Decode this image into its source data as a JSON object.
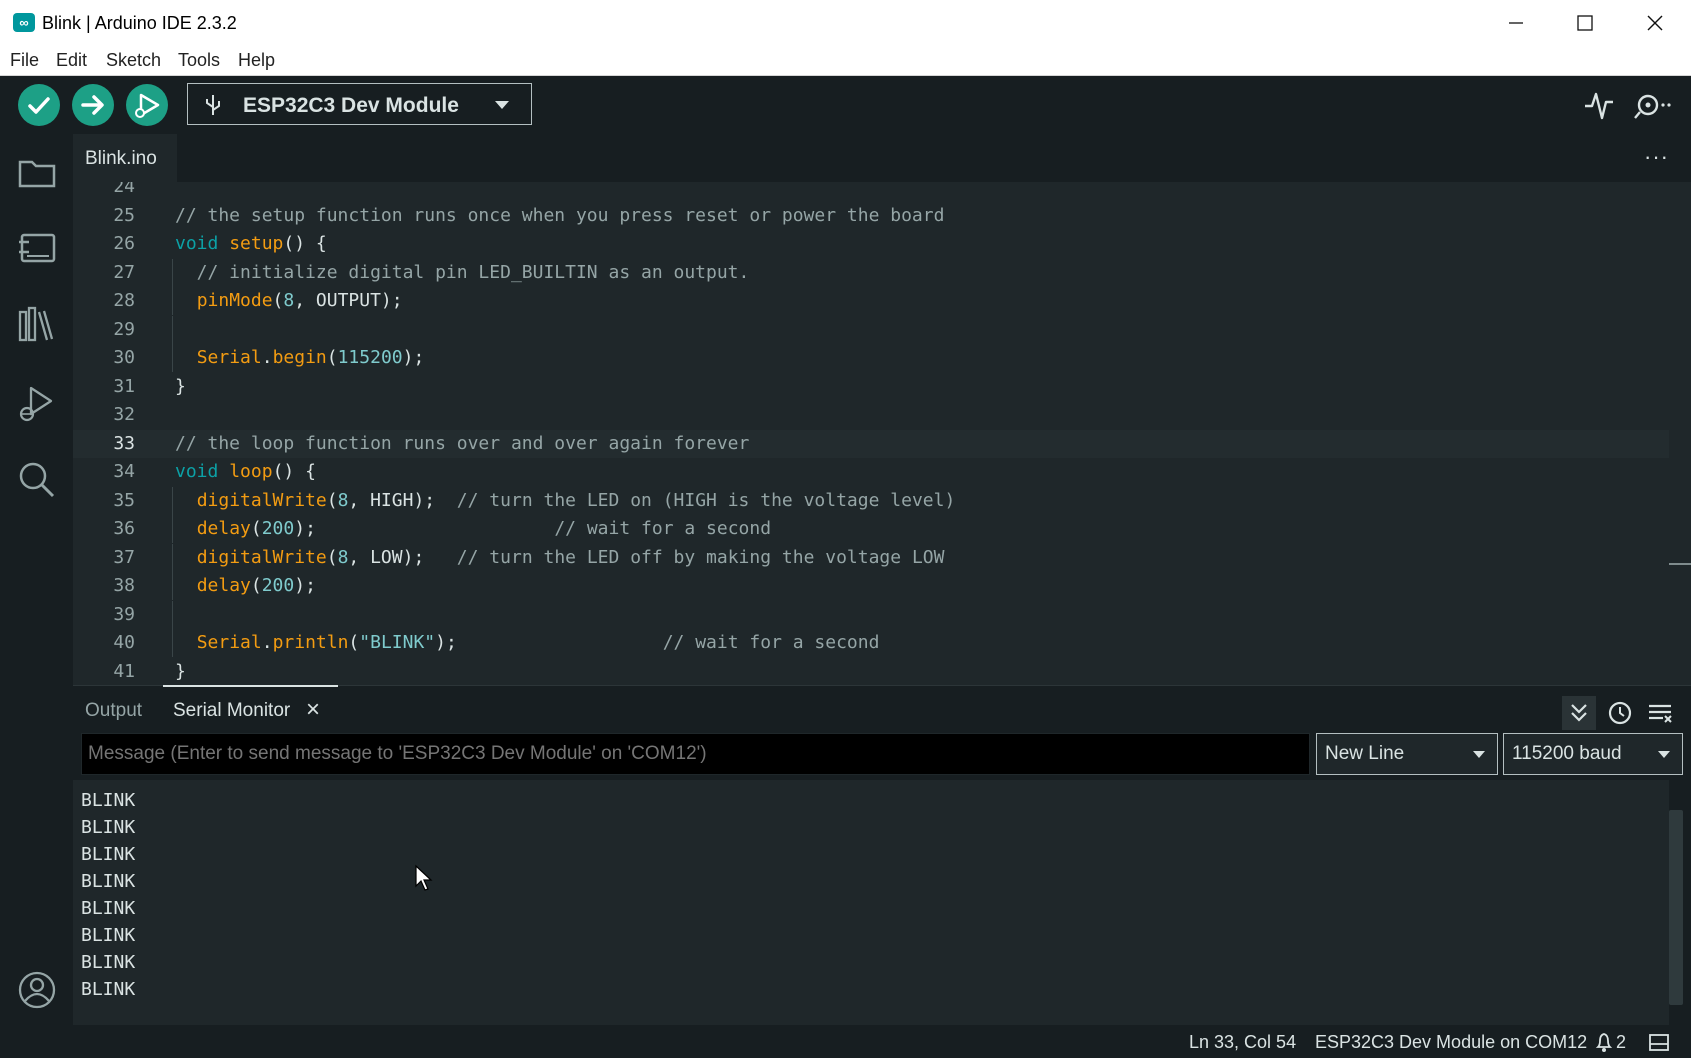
{
  "window": {
    "title": "Blink | Arduino IDE 2.3.2",
    "app_icon": "arduino-infinity-icon",
    "controls": [
      "minimize-icon",
      "maximize-icon",
      "close-icon"
    ]
  },
  "menu": [
    "File",
    "Edit",
    "Sketch",
    "Tools",
    "Help"
  ],
  "toolbar": {
    "verify": "check-icon",
    "upload": "arrow-right-icon",
    "debug": "debug-play-icon",
    "board": "ESP32C3 Dev Module",
    "serial_plotter": "pulse-icon",
    "serial_monitor": "serial-monitor-icon"
  },
  "sidebar": [
    "folder-icon",
    "board-icon",
    "library-icon",
    "debug-icon",
    "search-icon",
    "account-icon"
  ],
  "editor": {
    "tab": "Blink.ino",
    "more": "···",
    "active_line": 33,
    "lines": [
      {
        "n": "24",
        "tokens": []
      },
      {
        "n": "25",
        "tokens": [
          {
            "c": "t-cm",
            "t": "// the setup function runs once when you press reset or power the board"
          }
        ]
      },
      {
        "n": "26",
        "tokens": [
          {
            "c": "t-kw",
            "t": "void"
          },
          {
            "c": "t-txt",
            "t": " "
          },
          {
            "c": "t-fn",
            "t": "setup"
          },
          {
            "c": "t-txt",
            "t": "() {"
          }
        ]
      },
      {
        "n": "27",
        "tokens": [
          {
            "c": "t-cm",
            "t": "  // initialize digital pin LED_BUILTIN as an output."
          }
        ]
      },
      {
        "n": "28",
        "tokens": [
          {
            "c": "t-txt",
            "t": "  "
          },
          {
            "c": "t-fn",
            "t": "pinMode"
          },
          {
            "c": "t-txt",
            "t": "("
          },
          {
            "c": "t-num",
            "t": "8"
          },
          {
            "c": "t-txt",
            "t": ", OUTPUT);"
          }
        ]
      },
      {
        "n": "29",
        "tokens": []
      },
      {
        "n": "30",
        "tokens": [
          {
            "c": "t-txt",
            "t": "  "
          },
          {
            "c": "t-obj",
            "t": "Serial"
          },
          {
            "c": "t-txt",
            "t": "."
          },
          {
            "c": "t-fn",
            "t": "begin"
          },
          {
            "c": "t-txt",
            "t": "("
          },
          {
            "c": "t-num",
            "t": "115200"
          },
          {
            "c": "t-txt",
            "t": ");"
          }
        ]
      },
      {
        "n": "31",
        "tokens": [
          {
            "c": "t-txt",
            "t": "}"
          }
        ]
      },
      {
        "n": "32",
        "tokens": []
      },
      {
        "n": "33",
        "tokens": [
          {
            "c": "t-cm",
            "t": "// the loop function runs over and over again forever"
          }
        ]
      },
      {
        "n": "34",
        "tokens": [
          {
            "c": "t-kw",
            "t": "void"
          },
          {
            "c": "t-txt",
            "t": " "
          },
          {
            "c": "t-fn",
            "t": "loop"
          },
          {
            "c": "t-txt",
            "t": "() {"
          }
        ]
      },
      {
        "n": "35",
        "tokens": [
          {
            "c": "t-txt",
            "t": "  "
          },
          {
            "c": "t-fn",
            "t": "digitalWrite"
          },
          {
            "c": "t-txt",
            "t": "("
          },
          {
            "c": "t-num",
            "t": "8"
          },
          {
            "c": "t-txt",
            "t": ", HIGH);  "
          },
          {
            "c": "t-cm",
            "t": "// turn the LED on (HIGH is the voltage level)"
          }
        ]
      },
      {
        "n": "36",
        "tokens": [
          {
            "c": "t-txt",
            "t": "  "
          },
          {
            "c": "t-fn",
            "t": "delay"
          },
          {
            "c": "t-txt",
            "t": "("
          },
          {
            "c": "t-num",
            "t": "200"
          },
          {
            "c": "t-txt",
            "t": ");                      "
          },
          {
            "c": "t-cm",
            "t": "// wait for a second"
          }
        ]
      },
      {
        "n": "37",
        "tokens": [
          {
            "c": "t-txt",
            "t": "  "
          },
          {
            "c": "t-fn",
            "t": "digitalWrite"
          },
          {
            "c": "t-txt",
            "t": "("
          },
          {
            "c": "t-num",
            "t": "8"
          },
          {
            "c": "t-txt",
            "t": ", LOW);   "
          },
          {
            "c": "t-cm",
            "t": "// turn the LED off by making the voltage LOW"
          }
        ]
      },
      {
        "n": "38",
        "tokens": [
          {
            "c": "t-txt",
            "t": "  "
          },
          {
            "c": "t-fn",
            "t": "delay"
          },
          {
            "c": "t-txt",
            "t": "("
          },
          {
            "c": "t-num",
            "t": "200"
          },
          {
            "c": "t-txt",
            "t": ");"
          }
        ]
      },
      {
        "n": "39",
        "tokens": []
      },
      {
        "n": "40",
        "tokens": [
          {
            "c": "t-txt",
            "t": "  "
          },
          {
            "c": "t-obj",
            "t": "Serial"
          },
          {
            "c": "t-txt",
            "t": "."
          },
          {
            "c": "t-fn",
            "t": "println"
          },
          {
            "c": "t-txt",
            "t": "("
          },
          {
            "c": "t-str",
            "t": "\"BLINK\""
          },
          {
            "c": "t-txt",
            "t": ");                   "
          },
          {
            "c": "t-cm",
            "t": "// wait for a second"
          }
        ]
      },
      {
        "n": "41",
        "tokens": [
          {
            "c": "t-txt",
            "t": "}"
          }
        ]
      }
    ]
  },
  "panel": {
    "tabs": [
      "Output",
      "Serial Monitor"
    ],
    "active_tab": "Serial Monitor",
    "close": "×",
    "input_placeholder": "Message (Enter to send message to 'ESP32C3 Dev Module' on 'COM12')",
    "line_ending": "New Line",
    "baud": "115200 baud",
    "icons": [
      "autoscroll-icon",
      "timestamp-icon",
      "clear-output-icon"
    ],
    "output": [
      "BLINK",
      "BLINK",
      "BLINK",
      "BLINK",
      "BLINK",
      "BLINK",
      "BLINK",
      "BLINK"
    ]
  },
  "status": {
    "cursor": "Ln 33, Col 54",
    "board": "ESP32C3 Dev Module on COM12",
    "notifications": "2",
    "bell": "bell-icon",
    "layout": "panel-toggle-icon"
  },
  "colors": {
    "accent": "#1da086",
    "background": "#171e21",
    "editor": "#1f272a"
  }
}
